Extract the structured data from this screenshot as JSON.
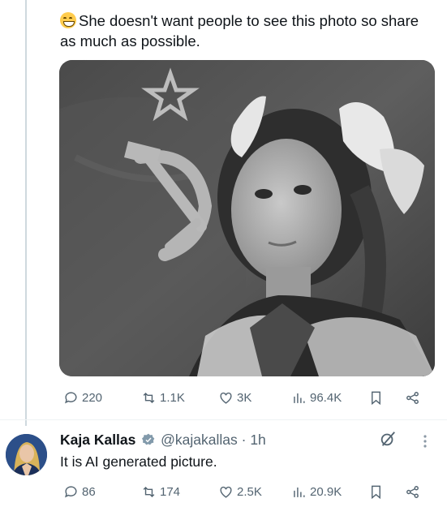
{
  "post": {
    "text": "She doesn't want people to see this photo so share as much as possible.",
    "emoji": "grinning-face-emoji",
    "stats": {
      "replies": "220",
      "reposts": "1.1K",
      "likes": "3K",
      "views": "96.4K"
    }
  },
  "reply": {
    "name": "Kaja Kallas",
    "handle": "@kajakallas",
    "separator": "·",
    "time": "1h",
    "text": "It is AI generated picture.",
    "stats": {
      "replies": "86",
      "reposts": "174",
      "likes": "2.5K",
      "views": "20.9K"
    }
  },
  "colors": {
    "text": "#0f1419",
    "secondary": "#536471",
    "verified_badge": "#829aab",
    "thread_line": "#cfd9de"
  }
}
